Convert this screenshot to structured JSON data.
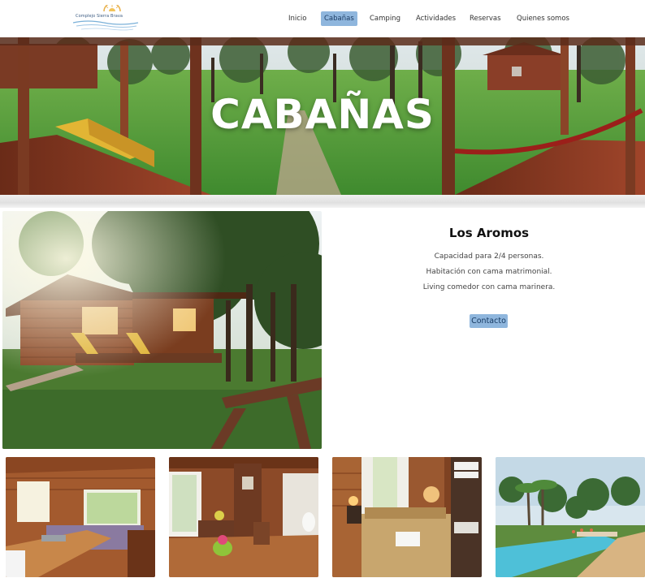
{
  "header": {
    "logo_text": "Complejo Sierra Brava",
    "nav": [
      {
        "label": "Inicio",
        "active": false
      },
      {
        "label": "Cabañas",
        "active": true
      },
      {
        "label": "Camping",
        "active": false
      },
      {
        "label": "Actividades",
        "active": false
      },
      {
        "label": "Reservas",
        "active": false
      },
      {
        "label": "Quienes somos",
        "active": false
      }
    ]
  },
  "hero": {
    "title": "CABAÑAS"
  },
  "cabin": {
    "name": "Los Aromos",
    "features": [
      "Capacidad para 2/4 personas.",
      "Habitación con cama matrimonial.",
      "Living comedor con cama marinera."
    ],
    "contact_label": "Contacto"
  },
  "colors": {
    "accent": "#8fb6dd",
    "accent_text": "#1e3e66"
  },
  "gallery": [
    {
      "name": "kitchen-photo"
    },
    {
      "name": "living-room-photo"
    },
    {
      "name": "bedroom-photo"
    },
    {
      "name": "pool-photo"
    }
  ]
}
